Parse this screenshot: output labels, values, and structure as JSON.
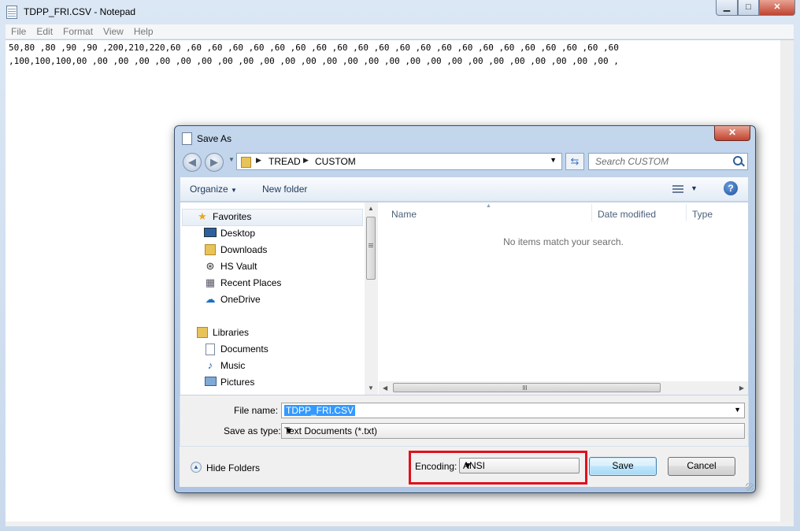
{
  "notepad": {
    "title": "TDPP_FRI.CSV - Notepad",
    "menu": [
      "File",
      "Edit",
      "Format",
      "View",
      "Help"
    ],
    "content_line1": "50,80 ,80 ,90 ,90 ,200,210,220,60 ,60 ,60 ,60 ,60 ,60 ,60 ,60 ,60 ,60 ,60 ,60 ,60 ,60 ,60 ,60 ,60 ,60 ,60 ,60 ,60 ,60",
    "content_line2": ",100,100,100,00 ,00 ,00 ,00 ,00 ,00 ,00 ,00 ,00 ,00 ,00 ,00 ,00 ,00 ,00 ,00 ,00 ,00 ,00 ,00 ,00 ,00 ,00 ,00 ,00 ,00 ,"
  },
  "dialog": {
    "title": "Save As",
    "address": {
      "crumbs": [
        "TREAD",
        "CUSTOM"
      ]
    },
    "search": {
      "placeholder": "Search CUSTOM"
    },
    "toolbar": {
      "organize": "Organize",
      "new_folder": "New folder"
    },
    "nav": {
      "favorites": {
        "label": "Favorites",
        "items": [
          {
            "label": "Desktop",
            "icon": "desktop-icon"
          },
          {
            "label": "Downloads",
            "icon": "downloads-icon"
          },
          {
            "label": "HS Vault",
            "icon": "vault-icon"
          },
          {
            "label": "Recent Places",
            "icon": "recent-places-icon"
          },
          {
            "label": "OneDrive",
            "icon": "cloud-icon"
          }
        ]
      },
      "libraries": {
        "label": "Libraries",
        "items": [
          {
            "label": "Documents",
            "icon": "documents-icon"
          },
          {
            "label": "Music",
            "icon": "music-icon"
          },
          {
            "label": "Pictures",
            "icon": "pictures-icon"
          }
        ]
      }
    },
    "columns": [
      "Name",
      "Date modified",
      "Type"
    ],
    "empty_message": "No items match your search.",
    "file_name_label": "File name:",
    "file_name_value": "TDPP_FRI.CSV",
    "save_type_label": "Save as type:",
    "save_type_value": "Text Documents (*.txt)",
    "hide_folders": "Hide Folders",
    "encoding_label": "Encoding:",
    "encoding_value": "ANSI",
    "save_button": "Save",
    "cancel_button": "Cancel",
    "highlight_color": "#e0101b"
  }
}
